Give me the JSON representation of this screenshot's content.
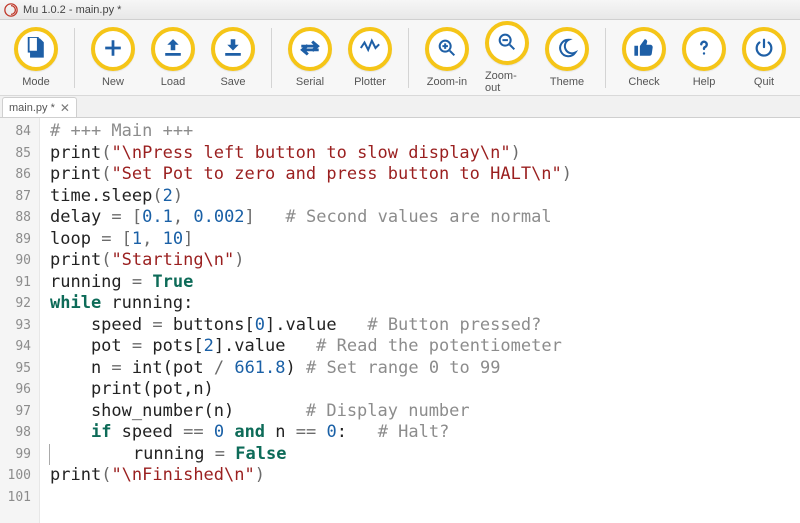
{
  "window": {
    "title": "Mu 1.0.2 - main.py *"
  },
  "toolbar": {
    "items": [
      {
        "id": "mode",
        "label": "Mode"
      },
      {
        "id": "new",
        "label": "New"
      },
      {
        "id": "load",
        "label": "Load"
      },
      {
        "id": "save",
        "label": "Save"
      },
      {
        "id": "serial",
        "label": "Serial"
      },
      {
        "id": "plotter",
        "label": "Plotter"
      },
      {
        "id": "zoom-in",
        "label": "Zoom-in"
      },
      {
        "id": "zoom-out",
        "label": "Zoom-out"
      },
      {
        "id": "theme",
        "label": "Theme"
      },
      {
        "id": "check",
        "label": "Check"
      },
      {
        "id": "help",
        "label": "Help"
      },
      {
        "id": "quit",
        "label": "Quit"
      }
    ]
  },
  "tabs": [
    {
      "label": "main.py *"
    }
  ],
  "editor": {
    "first_line": 84,
    "tokens": [
      [
        {
          "t": "# +++ Main +++",
          "c": "comment"
        }
      ],
      [
        {
          "t": "print",
          "c": "fn"
        },
        {
          "t": "(",
          "c": "op"
        },
        {
          "t": "\"\\nPress left button to slow display\\n\"",
          "c": "str"
        },
        {
          "t": ")",
          "c": "op"
        }
      ],
      [
        {
          "t": "print",
          "c": "fn"
        },
        {
          "t": "(",
          "c": "op"
        },
        {
          "t": "\"Set Pot to zero and press button to HALT\\n\"",
          "c": "str"
        },
        {
          "t": ")",
          "c": "op"
        }
      ],
      [
        {
          "t": "time.sleep",
          "c": "fn"
        },
        {
          "t": "(",
          "c": "op"
        },
        {
          "t": "2",
          "c": "num"
        },
        {
          "t": ")",
          "c": "op"
        }
      ],
      [
        {
          "t": "delay ",
          "c": ""
        },
        {
          "t": "=",
          "c": "op"
        },
        {
          "t": " [",
          "c": "op"
        },
        {
          "t": "0.1",
          "c": "num"
        },
        {
          "t": ", ",
          "c": "op"
        },
        {
          "t": "0.002",
          "c": "num"
        },
        {
          "t": "]",
          "c": "op"
        },
        {
          "t": "   ",
          "c": ""
        },
        {
          "t": "# Second values are normal",
          "c": "comment"
        }
      ],
      [
        {
          "t": "loop ",
          "c": ""
        },
        {
          "t": "=",
          "c": "op"
        },
        {
          "t": " [",
          "c": "op"
        },
        {
          "t": "1",
          "c": "num"
        },
        {
          "t": ", ",
          "c": "op"
        },
        {
          "t": "10",
          "c": "num"
        },
        {
          "t": "]",
          "c": "op"
        }
      ],
      [
        {
          "t": "print",
          "c": "fn"
        },
        {
          "t": "(",
          "c": "op"
        },
        {
          "t": "\"Starting\\n\"",
          "c": "str"
        },
        {
          "t": ")",
          "c": "op"
        }
      ],
      [
        {
          "t": "running ",
          "c": ""
        },
        {
          "t": "=",
          "c": "op"
        },
        {
          "t": " ",
          "c": ""
        },
        {
          "t": "True",
          "c": "kw"
        }
      ],
      [
        {
          "t": "while",
          "c": "kw"
        },
        {
          "t": " running:",
          "c": ""
        }
      ],
      [
        {
          "t": "    speed ",
          "c": ""
        },
        {
          "t": "=",
          "c": "op"
        },
        {
          "t": " buttons[",
          "c": ""
        },
        {
          "t": "0",
          "c": "num"
        },
        {
          "t": "].value   ",
          "c": ""
        },
        {
          "t": "# Button pressed?",
          "c": "comment"
        }
      ],
      [
        {
          "t": "    pot ",
          "c": ""
        },
        {
          "t": "=",
          "c": "op"
        },
        {
          "t": " pots[",
          "c": ""
        },
        {
          "t": "2",
          "c": "num"
        },
        {
          "t": "].value   ",
          "c": ""
        },
        {
          "t": "# Read the potentiometer",
          "c": "comment"
        }
      ],
      [
        {
          "t": "    n ",
          "c": ""
        },
        {
          "t": "=",
          "c": "op"
        },
        {
          "t": " ",
          "c": ""
        },
        {
          "t": "int",
          "c": "fn"
        },
        {
          "t": "(pot ",
          "c": ""
        },
        {
          "t": "/",
          "c": "op"
        },
        {
          "t": " ",
          "c": ""
        },
        {
          "t": "661.8",
          "c": "num"
        },
        {
          "t": ") ",
          "c": ""
        },
        {
          "t": "# Set range 0 to 99",
          "c": "comment"
        }
      ],
      [
        {
          "t": "    ",
          "c": ""
        },
        {
          "t": "print",
          "c": "fn"
        },
        {
          "t": "(pot,n)",
          "c": ""
        }
      ],
      [
        {
          "t": "    show_number(n)       ",
          "c": ""
        },
        {
          "t": "# Display number",
          "c": "comment"
        }
      ],
      [
        {
          "t": "    ",
          "c": ""
        },
        {
          "t": "if",
          "c": "kw"
        },
        {
          "t": " speed ",
          "c": ""
        },
        {
          "t": "==",
          "c": "op"
        },
        {
          "t": " ",
          "c": ""
        },
        {
          "t": "0",
          "c": "num"
        },
        {
          "t": " ",
          "c": ""
        },
        {
          "t": "and",
          "c": "kw"
        },
        {
          "t": " n ",
          "c": ""
        },
        {
          "t": "==",
          "c": "op"
        },
        {
          "t": " ",
          "c": ""
        },
        {
          "t": "0",
          "c": "num"
        },
        {
          "t": ":   ",
          "c": ""
        },
        {
          "t": "# Halt?",
          "c": "comment"
        }
      ],
      [
        {
          "t": "        running ",
          "c": ""
        },
        {
          "t": "=",
          "c": "op"
        },
        {
          "t": " ",
          "c": ""
        },
        {
          "t": "False",
          "c": "kw"
        }
      ],
      [
        {
          "t": "print",
          "c": "fn"
        },
        {
          "t": "(",
          "c": "op"
        },
        {
          "t": "\"\\nFinished\\n\"",
          "c": "str"
        },
        {
          "t": ")",
          "c": "op"
        }
      ],
      [
        {
          "t": "",
          "c": ""
        }
      ]
    ]
  }
}
